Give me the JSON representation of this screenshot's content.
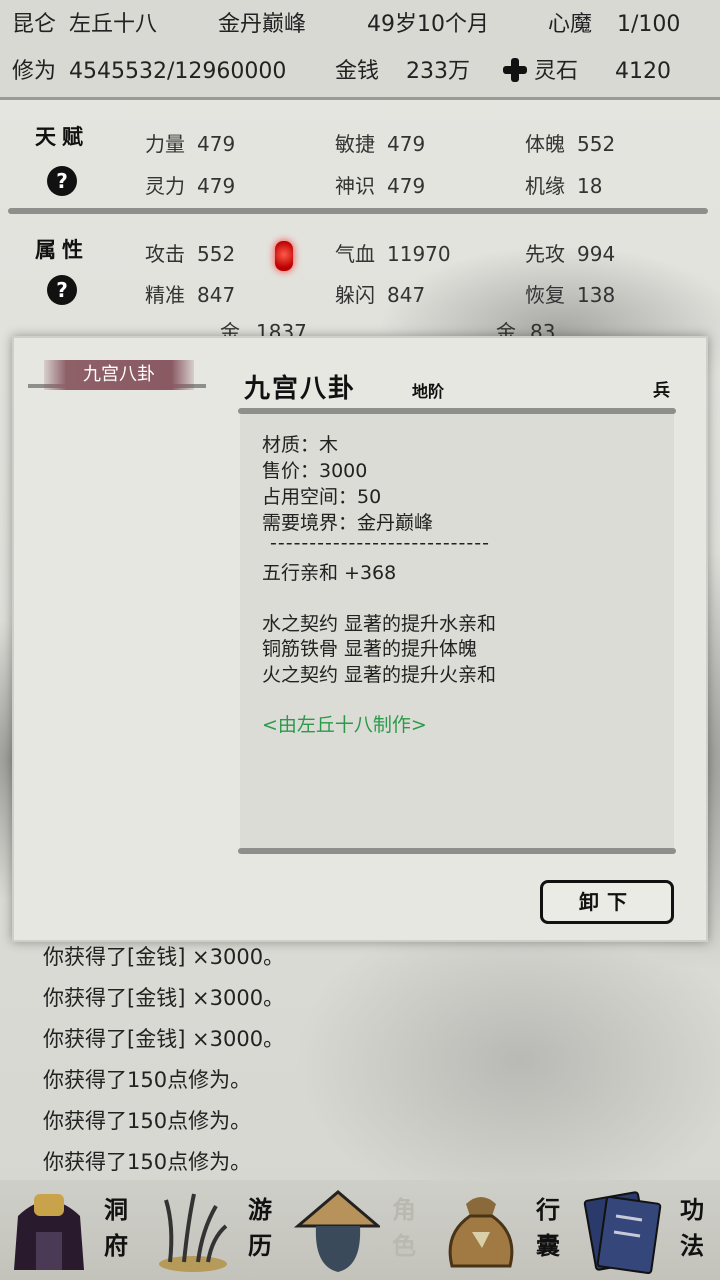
{
  "header": {
    "sect": "昆仑",
    "name": "左丘十八",
    "realm": "金丹巅峰",
    "age": "49岁10个月",
    "demon_label": "心魔",
    "demon_value": "1/100",
    "cultivation_label": "修为",
    "cultivation_value": "4545532/12960000",
    "money_label": "金钱",
    "money_value": "233万",
    "stone_label": "灵石",
    "stone_value": "4120"
  },
  "talent": {
    "title": "天赋",
    "help": "?",
    "stats": [
      {
        "label": "力量",
        "value": "479"
      },
      {
        "label": "敏捷",
        "value": "479"
      },
      {
        "label": "体魄",
        "value": "552"
      },
      {
        "label": "灵力",
        "value": "479"
      },
      {
        "label": "神识",
        "value": "479"
      },
      {
        "label": "机缘",
        "value": "18"
      }
    ]
  },
  "attributes": {
    "title": "属性",
    "help": "?",
    "stats": [
      {
        "label": "攻击",
        "value": "552"
      },
      {
        "label": "气血",
        "value": "11970"
      },
      {
        "label": "先攻",
        "value": "994"
      },
      {
        "label": "精准",
        "value": "847"
      },
      {
        "label": "躲闪",
        "value": "847"
      },
      {
        "label": "恢复",
        "value": "138"
      }
    ],
    "partial": [
      {
        "label": "金",
        "value": "1837"
      },
      {
        "label": "金",
        "value": "83"
      }
    ]
  },
  "dialog": {
    "tab_label": "九宫八卦",
    "item_name": "九宫八卦",
    "item_grade": "地阶",
    "item_type": "兵",
    "details": [
      "材质：木",
      "售价：3000",
      "占用空间：50",
      "需要境界：金丹巅峰",
      "----------------------------",
      "五行亲和 +368",
      "水之契约 显著的提升水亲和",
      "铜筋铁骨 显著的提升体魄",
      "火之契约 显著的提升火亲和"
    ],
    "maker": "<由左丘十八制作>",
    "unequip_label": "卸下"
  },
  "log": [
    "你获得了[金钱] ×3000。",
    "你获得了[金钱] ×3000。",
    "你获得了[金钱] ×3000。",
    "你获得了150点修为。",
    "你获得了150点修为。",
    "你获得了150点修为。"
  ],
  "nav": [
    {
      "label": "洞府",
      "icon": "cave-dwelling-icon"
    },
    {
      "label": "游历",
      "icon": "travel-grass-icon"
    },
    {
      "label": "角色",
      "icon": "character-hat-icon",
      "active": true
    },
    {
      "label": "行囊",
      "icon": "bag-icon"
    },
    {
      "label": "功法",
      "icon": "scroll-books-icon"
    }
  ],
  "colors": {
    "accent_green": "#2a9a4a",
    "tab_red": "#8a5a63",
    "lantern_red": "#d11"
  }
}
